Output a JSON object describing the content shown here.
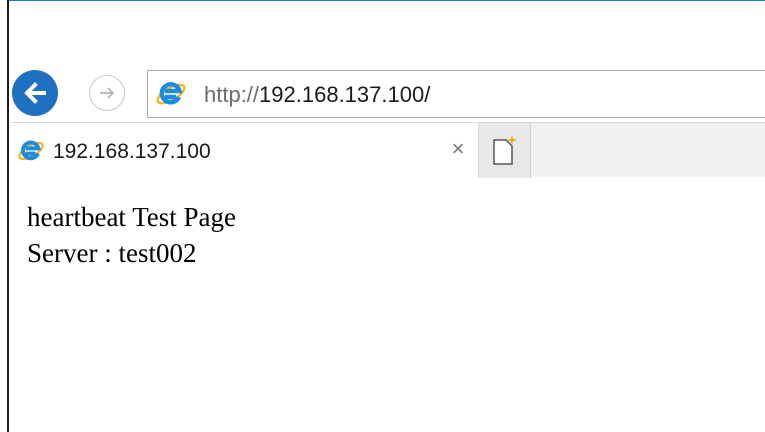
{
  "navigation": {
    "back_icon": "back-arrow-icon",
    "forward_icon": "forward-arrow-icon",
    "address": {
      "scheme": "http://",
      "host": "192.168.137.100/",
      "icon": "ie-logo-icon"
    }
  },
  "tabs": [
    {
      "title": "192.168.137.100",
      "close_label": "×",
      "icon": "ie-logo-icon"
    }
  ],
  "new_tab_icon": "new-tab-icon",
  "page": {
    "heading": "heartbeat Test Page",
    "server_line": "Server : test002"
  },
  "colors": {
    "accent": "#1f70c1",
    "ie_blue": "#1d8ce0",
    "ie_ring": "#f2b81e"
  }
}
